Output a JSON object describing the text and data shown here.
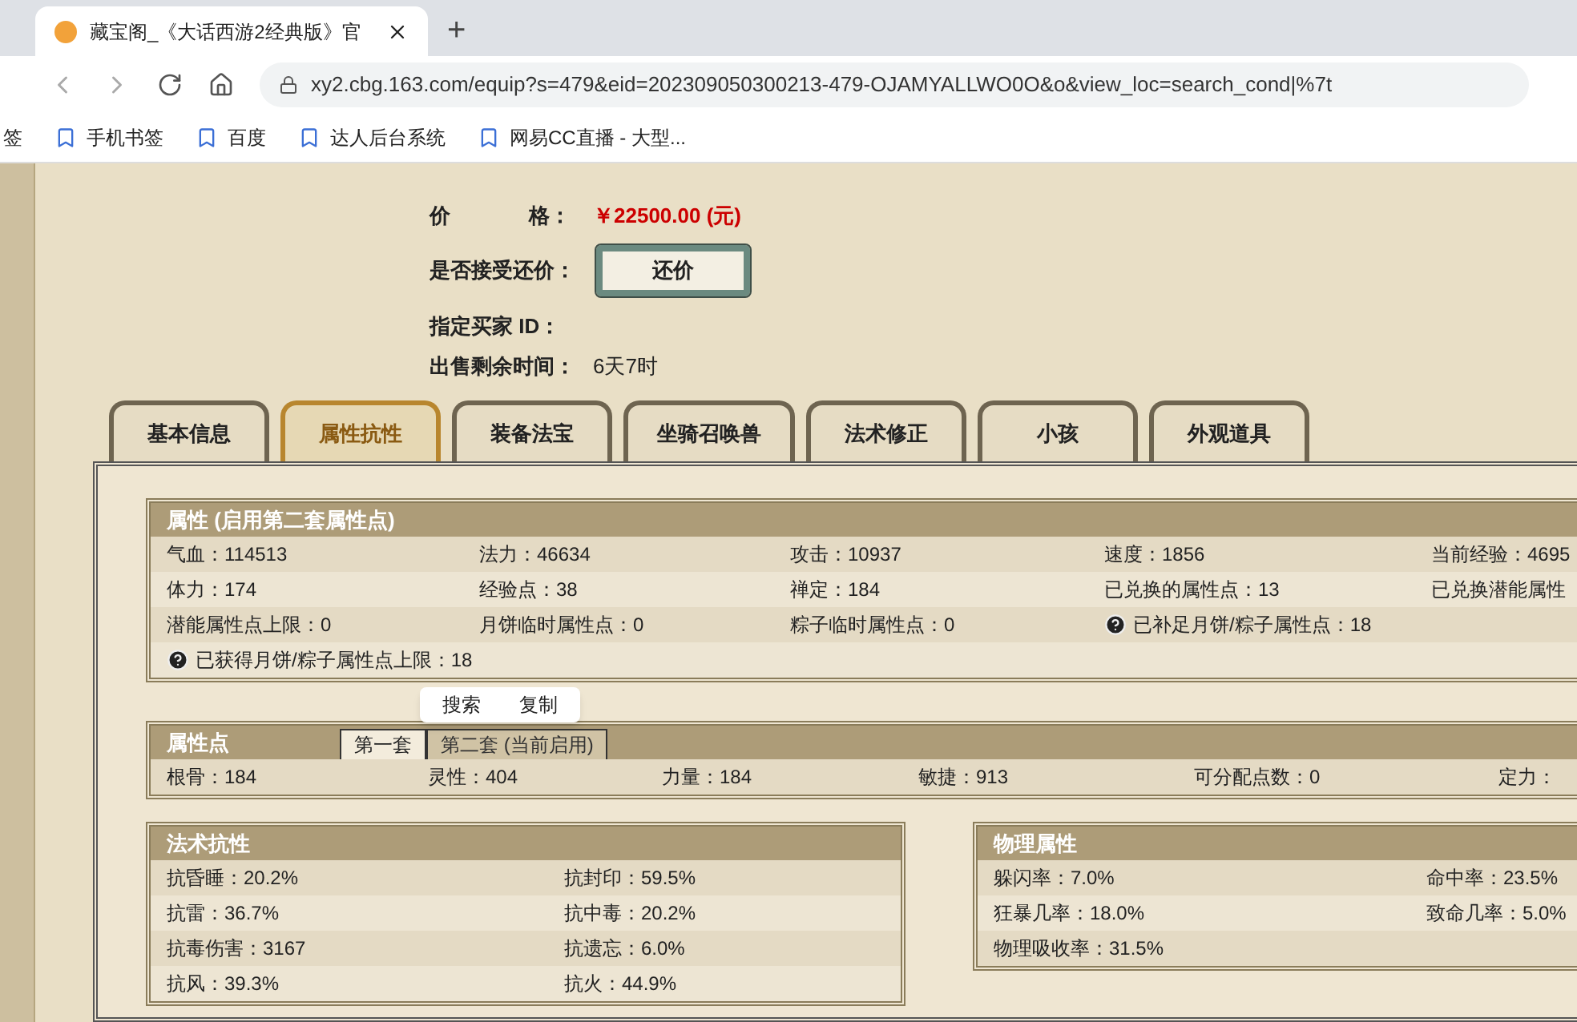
{
  "browser": {
    "tab_title": "藏宝阁_《大话西游2经典版》官",
    "new_tab": "+",
    "url": "xy2.cbg.163.com/equip?s=479&eid=202309050300213-479-OJAMYALLWO0O&o&view_loc=search_cond|%7t",
    "bookmarks": [
      {
        "label": "签"
      },
      {
        "label": "手机书签"
      },
      {
        "label": "百度"
      },
      {
        "label": "达人后台系统"
      },
      {
        "label": "网易CC直播 - 大型..."
      }
    ]
  },
  "sale": {
    "price_label": "价",
    "price_label_2": "格：",
    "price": "￥22500.00 (元)",
    "bargain_label": "是否接受还价：",
    "bargain_button": "还价",
    "buyer_label": "指定买家 ID：",
    "remaining_label": "出售剩余时间：",
    "remaining": "6天7时"
  },
  "tabs": [
    {
      "label": "基本信息",
      "selected": false
    },
    {
      "label": "属性抗性",
      "selected": true
    },
    {
      "label": "装备法宝",
      "selected": false
    },
    {
      "label": "坐骑召唤兽",
      "selected": false
    },
    {
      "label": "法术修正",
      "selected": false
    },
    {
      "label": "小孩",
      "selected": false
    },
    {
      "label": "外观道具",
      "selected": false
    }
  ],
  "attributes": {
    "title": "属性 (启用第二套属性点)",
    "rows": [
      [
        "气血：114513",
        "法力：46634",
        "攻击：10937",
        "速度：1856",
        "当前经验：4695"
      ],
      [
        "体力：174",
        "经验点：38",
        "禅定：184",
        "已兑换的属性点：13",
        "已兑换潜能属性"
      ],
      [
        "潜能属性点上限：0",
        "月饼临时属性点：0",
        "粽子临时属性点：0",
        {
          "text": "已补足月饼/粽子属性点：18",
          "help": true
        }
      ],
      [
        {
          "text": "已获得月饼/粽子属性点上限：18",
          "help": true
        }
      ]
    ]
  },
  "attribute_points": {
    "title": "属性点",
    "subtabs": [
      {
        "label": "第一套",
        "selected": true
      },
      {
        "label": "第二套 (当前启用)",
        "selected": false
      }
    ],
    "values": [
      "根骨：184",
      "灵性：404",
      "力量：184",
      "敏捷：913",
      "可分配点数：0",
      "定力："
    ]
  },
  "context_menu": [
    "搜索",
    "复制"
  ],
  "magic_resist": {
    "title": "法术抗性",
    "rows": [
      [
        "抗昏睡：20.2%",
        "抗封印：59.5%"
      ],
      [
        "抗雷：36.7%",
        "抗中毒：20.2%"
      ],
      [
        "抗毒伤害：3167",
        "抗遗忘：6.0%"
      ],
      [
        "抗风：39.3%",
        "抗火：44.9%"
      ]
    ]
  },
  "physical": {
    "title": "物理属性",
    "rows": [
      [
        "躲闪率：7.0%",
        "命中率：23.5%"
      ],
      [
        "狂暴几率：18.0%",
        "致命几率：5.0%"
      ],
      [
        "物理吸收率：31.5%"
      ]
    ]
  }
}
